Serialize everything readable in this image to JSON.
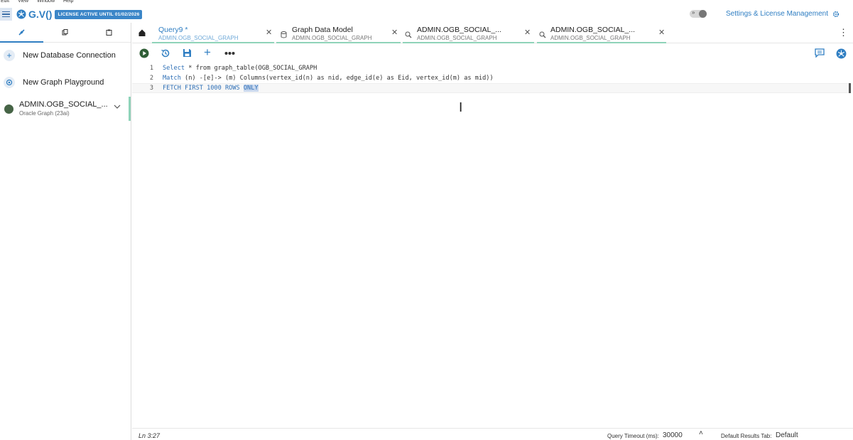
{
  "menu": [
    "Edit",
    "View",
    "Window",
    "Help"
  ],
  "header": {
    "logo": "G.V()",
    "license": "LICENSE ACTIVE UNTIL 01/02/2026",
    "settings_label": "Settings & License Management",
    "toggle_chevron": "»"
  },
  "sidebar": {
    "tabs": [
      {
        "icon": "connect-icon"
      },
      {
        "icon": "copy-icon"
      },
      {
        "icon": "clipboard-icon"
      }
    ],
    "items": [
      {
        "label": "New Database Connection",
        "icon": "plus-icon"
      },
      {
        "label": "New Graph Playground",
        "icon": "graph-playground-icon"
      }
    ],
    "connection": {
      "name": "ADMIN.OGB_SOCIAL_...",
      "type": "Oracle Graph (23ai)",
      "status_color": "#466446"
    }
  },
  "tabs": [
    {
      "title": "Query9 *",
      "subtitle": "ADMIN.OGB_SOCIAL_GRAPH",
      "icon": "",
      "active": true
    },
    {
      "title": "Graph Data Model",
      "subtitle": "ADMIN.OGB_SOCIAL_GRAPH",
      "icon": "database-icon"
    },
    {
      "title": "ADMIN.OGB_SOCIAL_...",
      "subtitle": "ADMIN.OGB_SOCIAL_GRAPH",
      "icon": "graph-search-icon"
    },
    {
      "title": "ADMIN.OGB_SOCIAL_...",
      "subtitle": "ADMIN.OGB_SOCIAL_GRAPH",
      "icon": "graph-search-icon"
    }
  ],
  "editor": {
    "line_numbers": [
      "1",
      "2",
      "3"
    ],
    "lines": [
      {
        "kw": "Select",
        "rest": " * from graph_table(OGB_SOCIAL_GRAPH"
      },
      {
        "kw": "Match",
        "rest": " (n) -[e]-> (m) Columns(vertex_id(n) as nid, edge_id(e) as Eid, vertex_id(m) as mid))"
      },
      {
        "kw": "FETCH FIRST 1000 ROWS",
        "rest": "",
        "selected": "ONLY"
      }
    ]
  },
  "status": {
    "position": "Ln 3:27",
    "timeout_label": "Query Timeout (ms):",
    "timeout_value": "30000",
    "results_tab_label": "Default Results Tab:",
    "results_tab_value": "Default"
  },
  "colors": {
    "accent": "#2f7ec2",
    "license_bg": "#3b86c8",
    "active_tab_underline": "#8fd3b9"
  }
}
